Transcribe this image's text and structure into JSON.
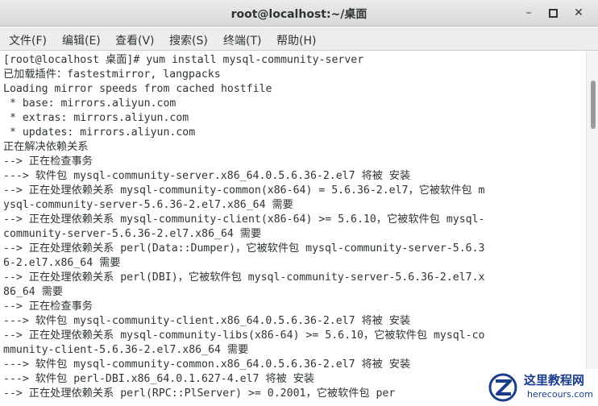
{
  "window": {
    "title": "root@localhost:~/桌面",
    "minimize_glyph": "–",
    "close_glyph": "✕"
  },
  "menu": [
    "文件(F)",
    "编辑(E)",
    "查看(V)",
    "搜索(S)",
    "终端(T)",
    "帮助(H)"
  ],
  "terminal": {
    "lines": [
      "[root@localhost 桌面]# yum install mysql-community-server",
      "已加载插件：fastestmirror, langpacks",
      "Loading mirror speeds from cached hostfile",
      " * base: mirrors.aliyun.com",
      " * extras: mirrors.aliyun.com",
      " * updates: mirrors.aliyun.com",
      "正在解决依赖关系",
      "--> 正在检查事务",
      "---> 软件包 mysql-community-server.x86_64.0.5.6.36-2.el7 将被 安装",
      "--> 正在处理依赖关系 mysql-community-common(x86-64) = 5.6.36-2.el7，它被软件包 m",
      "ysql-community-server-5.6.36-2.el7.x86_64 需要",
      "--> 正在处理依赖关系 mysql-community-client(x86-64) >= 5.6.10，它被软件包 mysql-",
      "community-server-5.6.36-2.el7.x86_64 需要",
      "--> 正在处理依赖关系 perl(Data::Dumper)，它被软件包 mysql-community-server-5.6.3",
      "6-2.el7.x86_64 需要",
      "--> 正在处理依赖关系 perl(DBI)，它被软件包 mysql-community-server-5.6.36-2.el7.x",
      "86_64 需要",
      "--> 正在检查事务",
      "---> 软件包 mysql-community-client.x86_64.0.5.6.36-2.el7 将被 安装",
      "--> 正在处理依赖关系 mysql-community-libs(x86-64) >= 5.6.10，它被软件包 mysql-co",
      "mmunity-client-5.6.36-2.el7.x86_64 需要",
      "---> 软件包 mysql-community-common.x86_64.0.5.6.36-2.el7 将被 安装",
      "---> 软件包 perl-DBI.x86_64.0.1.627-4.el7 将被 安装",
      "--> 正在处理依赖关系 perl(RPC::PlServer) >= 0.2001，它被软件包 per"
    ]
  },
  "watermark": {
    "name": "这里教程网",
    "url": "herecours.com"
  },
  "colors": {
    "text": "#2e3436",
    "watermark": "#1a3c8c"
  }
}
